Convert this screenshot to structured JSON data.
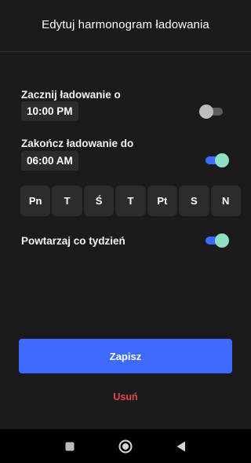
{
  "header": {
    "title": "Edytuj harmonogram ładowania"
  },
  "start": {
    "label": "Zacznij ładowanie o",
    "time": "10:00 PM",
    "enabled": false
  },
  "end": {
    "label": "Zakończ ładowanie do",
    "time": "06:00 AM",
    "enabled": true
  },
  "days": [
    {
      "label": "Pn"
    },
    {
      "label": "T"
    },
    {
      "label": "Ś"
    },
    {
      "label": "T"
    },
    {
      "label": "Pt"
    },
    {
      "label": "S"
    },
    {
      "label": "N"
    }
  ],
  "repeat": {
    "label": "Powtarzaj co tydzień",
    "enabled": true
  },
  "actions": {
    "save_label": "Zapisz",
    "delete_label": "Usuń"
  },
  "navbar": {
    "icons": [
      "recents-square-icon",
      "home-circle-icon",
      "back-triangle-icon"
    ]
  },
  "colors": {
    "background": "#1b1b1d",
    "chip": "#2c2c2f",
    "accent_blue": "#3e6bff",
    "toggle_thumb_on": "#8ee0c5",
    "danger": "#e4494a"
  }
}
